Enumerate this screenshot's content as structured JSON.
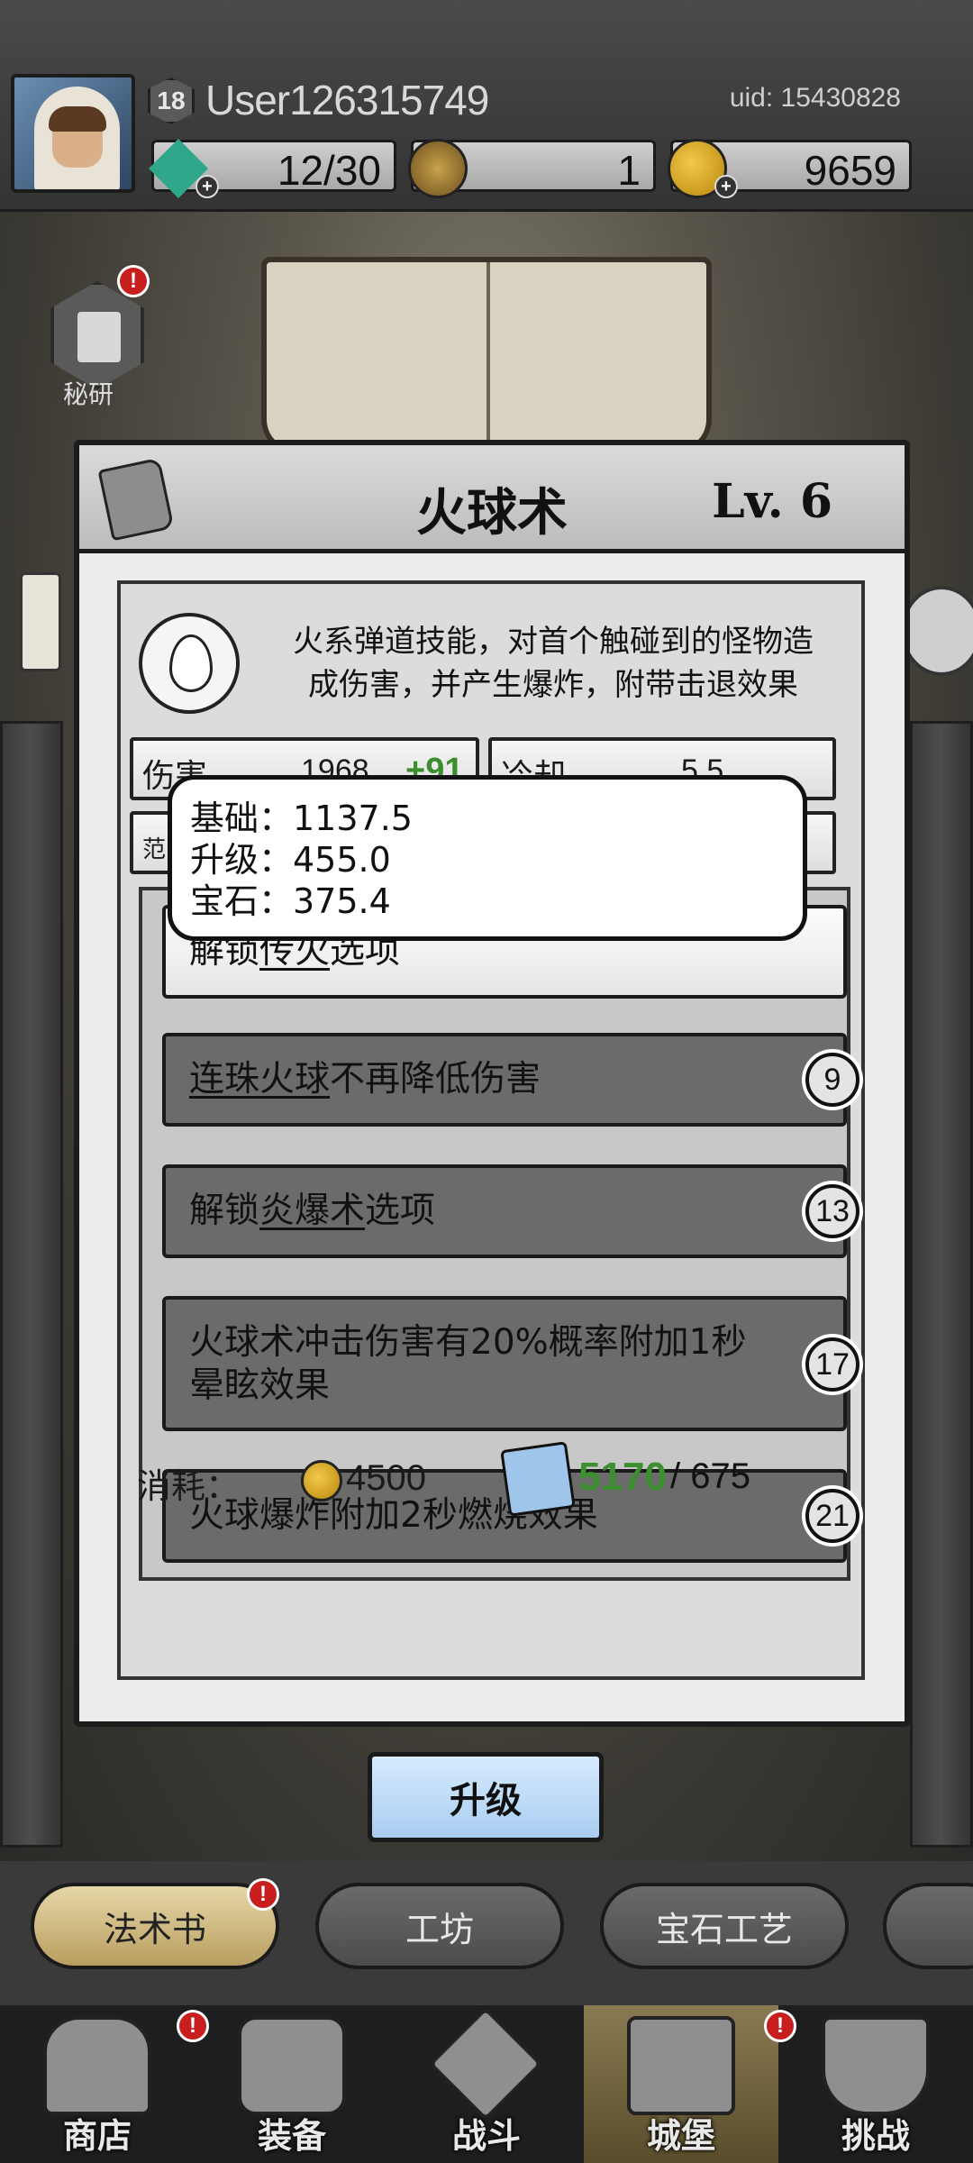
{
  "header": {
    "player_level": "18",
    "username": "User126315749",
    "uid": "uid: 15430828",
    "gems": "12/30",
    "mechanism": "1",
    "gold": "9659"
  },
  "side": {
    "secret_label": "秘研",
    "secret_alert": "!"
  },
  "skill": {
    "name": "火球术",
    "level": "Lv.  6",
    "description_line1": "火系弹道技能，对首个触碰到的怪物造",
    "description_line2": "成伤害，并产生爆炸，附带击退效果",
    "stats": {
      "damage_label": "伤害",
      "damage_value": "1968",
      "damage_bonus": "+91",
      "cooldown_label": "冷却",
      "cooldown_value": "5.5",
      "range_label_partial": "范"
    },
    "damage_breakdown": {
      "base": "基础：1137.5",
      "upgrade": "升级：455.0",
      "gem": "宝石：375.4"
    },
    "options": [
      {
        "prefix": "解锁",
        "highlight": "传火",
        "suffix": "选项",
        "level_req": ""
      },
      {
        "prefix": "",
        "highlight": "连珠火球",
        "suffix": "不再降低伤害",
        "level_req": "9"
      },
      {
        "prefix": "解锁",
        "highlight": "炎爆术",
        "suffix": "选项",
        "level_req": "13"
      },
      {
        "prefix": "",
        "highlight": "",
        "suffix": "火球术冲击伤害有20%概率附加1秒晕眩效果",
        "line1": "火球术冲击伤害有20%概率附加1秒",
        "line2": "晕眩效果",
        "level_req": "17"
      },
      {
        "prefix": "",
        "highlight": "",
        "suffix": "火球爆炸附加2秒燃烧效果",
        "level_req": "21"
      }
    ],
    "cost": {
      "label": "消耗：",
      "gold": "4500",
      "fragments_have": "5170",
      "fragments_need": "/ 675"
    },
    "upgrade_label": "升级"
  },
  "subtabs": [
    {
      "label": "法术书",
      "active": true,
      "alert": "!"
    },
    {
      "label": "工坊",
      "active": false
    },
    {
      "label": "宝石工艺",
      "active": false
    }
  ],
  "bottom_nav": [
    {
      "label": "商店",
      "alert": "!"
    },
    {
      "label": "装备"
    },
    {
      "label": "战斗"
    },
    {
      "label": "城堡",
      "alert": "!"
    },
    {
      "label": "挑战"
    }
  ],
  "colors": {
    "bonus_green": "#3c8f2e",
    "upgrade_button": "#a9cdf0",
    "alert_red": "#c81e1e"
  }
}
